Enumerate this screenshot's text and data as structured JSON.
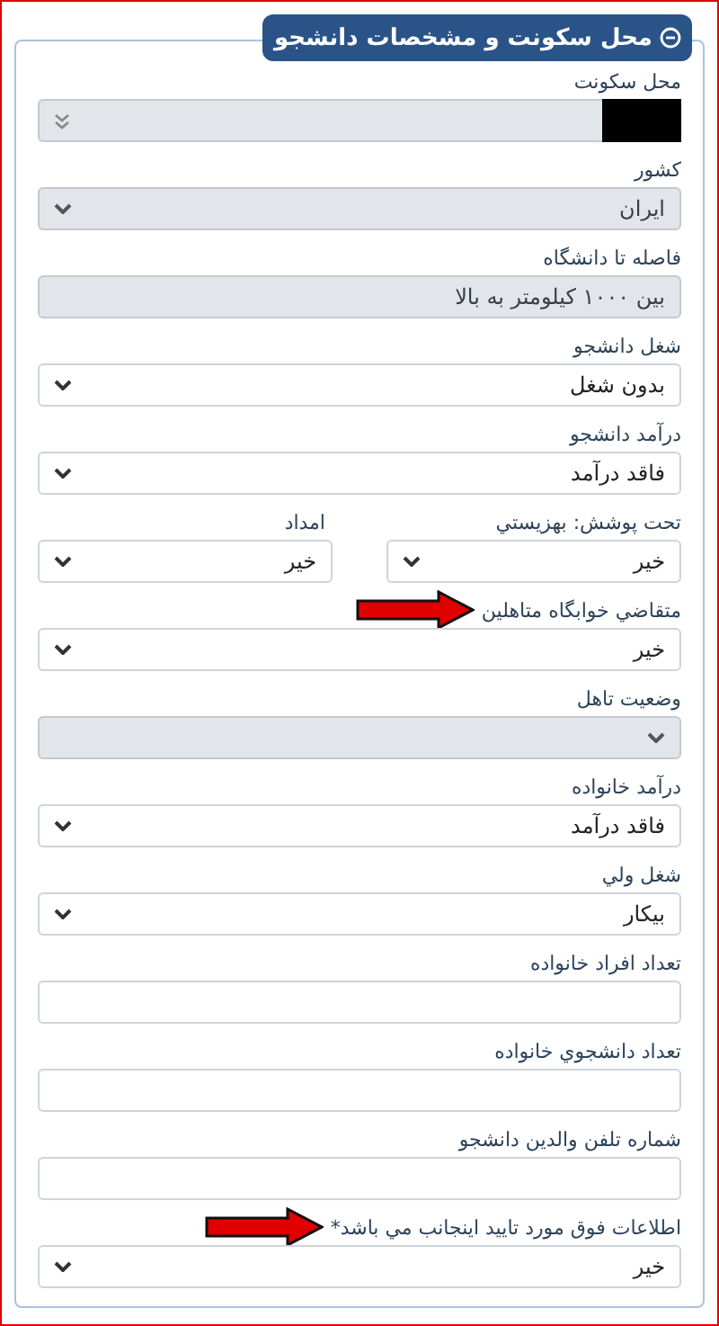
{
  "section": {
    "title": "محل سکونت و مشخصات دانشجو",
    "expanded": true
  },
  "fields": [
    {
      "kind": "redacted-select",
      "label": "محل سکونت",
      "disabled": true,
      "annotated": false
    },
    {
      "kind": "select",
      "label": "کشور",
      "value": "ایران",
      "disabled": true,
      "annotated": false
    },
    {
      "kind": "text",
      "label": "فاصله تا دانشگاه",
      "value": "بین ۱۰۰۰ کیلومتر به بالا",
      "disabled": true,
      "annotated": false
    },
    {
      "kind": "select",
      "label": "شغل دانشجو",
      "value": "بدون شغل",
      "disabled": false,
      "annotated": false
    },
    {
      "kind": "select",
      "label": "درآمد دانشجو",
      "value": "فاقد درآمد",
      "disabled": false,
      "annotated": false
    },
    {
      "kind": "pair",
      "disabled": false,
      "annotated": false,
      "items": [
        {
          "label": "تحت پوشش: بهزیستي",
          "value": "خیر"
        },
        {
          "label": "امداد",
          "value": "خیر"
        }
      ]
    },
    {
      "kind": "select",
      "label": "متقاضي خوابگاه متاهلين",
      "value": "خیر",
      "disabled": false,
      "annotated": true
    },
    {
      "kind": "select",
      "label": "وضعیت تاهل",
      "disabled": true,
      "annotated": false
    },
    {
      "kind": "select",
      "label": "درآمد خانواده",
      "value": "فاقد درآمد",
      "disabled": false,
      "annotated": false
    },
    {
      "kind": "select",
      "label": "شغل ولي",
      "value": "بیکار",
      "disabled": false,
      "annotated": false
    },
    {
      "kind": "input",
      "label": "تعداد افراد خانواده",
      "disabled": false,
      "annotated": false
    },
    {
      "kind": "input",
      "label": "تعداد دانشجوي خانواده",
      "disabled": false,
      "annotated": false
    },
    {
      "kind": "input",
      "label": "شماره تلفن والدین دانشجو",
      "disabled": false,
      "annotated": false
    },
    {
      "kind": "select",
      "label": "اطلاعات فوق مورد تایید اینجانب مي باشد*",
      "value": "خیر",
      "disabled": false,
      "annotated": true
    }
  ]
}
